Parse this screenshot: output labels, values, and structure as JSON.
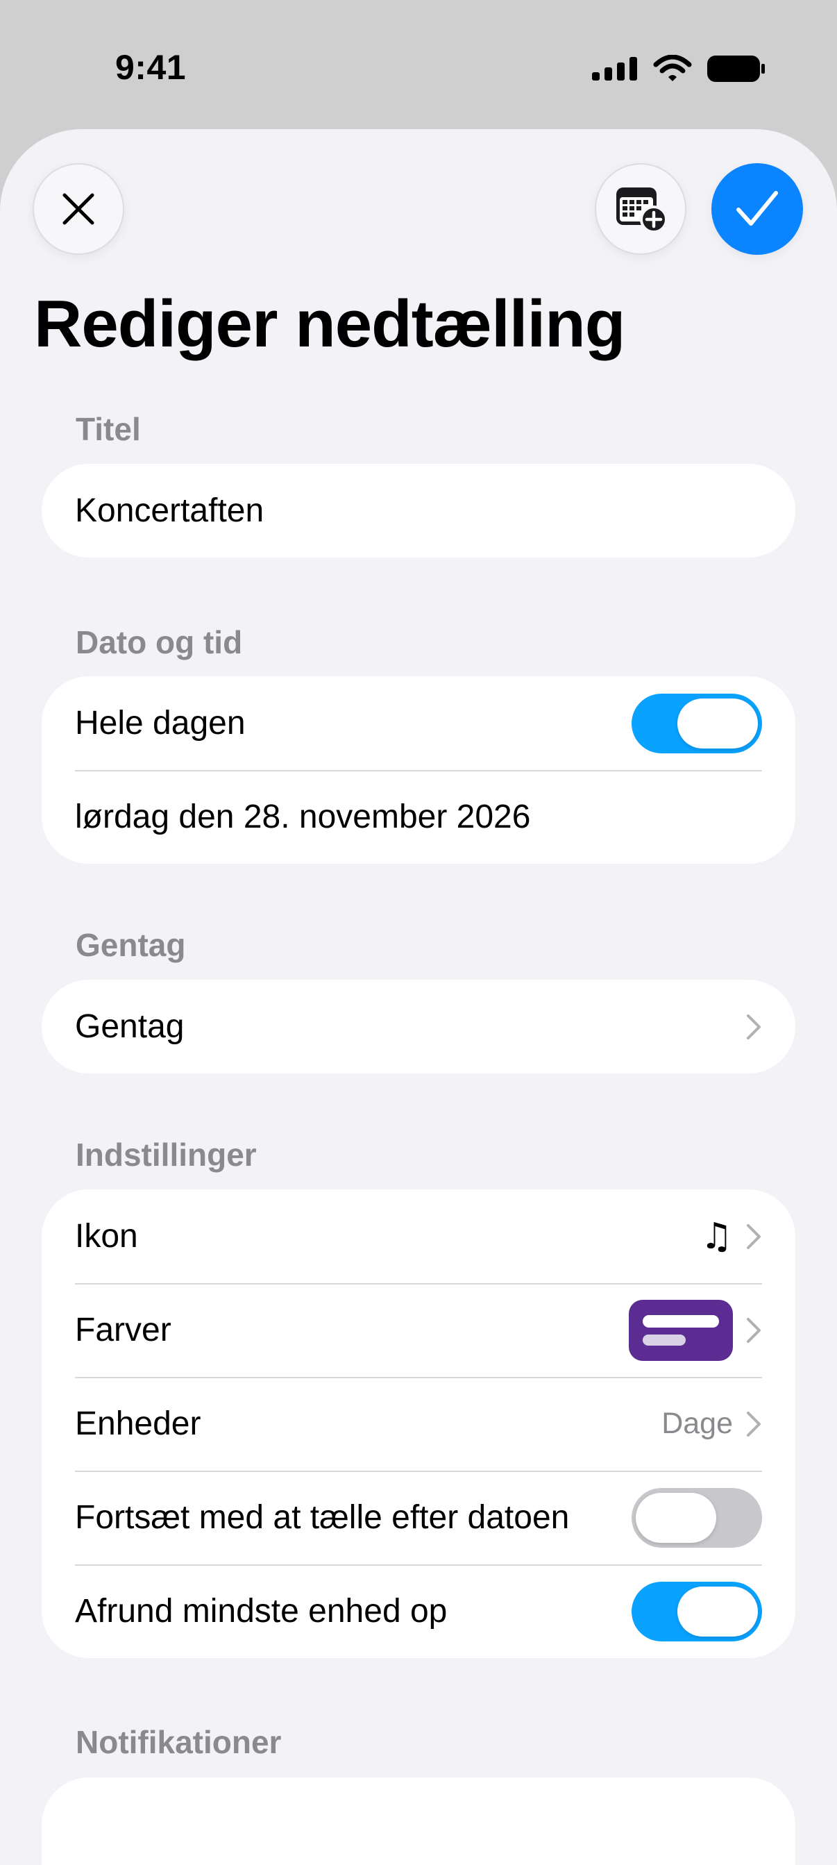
{
  "status": {
    "time": "9:41"
  },
  "header": {
    "title": "Rediger nedtælling",
    "close_icon": "xmark-icon",
    "calendar_icon": "calendar-badge-plus-icon",
    "done_icon": "checkmark-icon",
    "accent_color": "#0a84ff"
  },
  "sections": {
    "title": {
      "label": "Titel",
      "value": "Koncertaften"
    },
    "datetime": {
      "label": "Dato og tid",
      "all_day_label": "Hele dagen",
      "all_day_on": true,
      "date": "lørdag den 28. november 2026"
    },
    "repeat": {
      "label": "Gentag",
      "row_label": "Gentag"
    },
    "settings": {
      "label": "Indstillinger",
      "icon_label": "Ikon",
      "icon_value": "music-note-icon",
      "colors_label": "Farver",
      "colors_swatch": "#5b2c91",
      "units_label": "Enheder",
      "units_value": "Dage",
      "continue_label": "Fortsæt med at tælle efter datoen",
      "continue_on": false,
      "round_label": "Afrund mindste enhed op",
      "round_on": true
    },
    "notifications": {
      "label": "Notifikationer"
    }
  }
}
